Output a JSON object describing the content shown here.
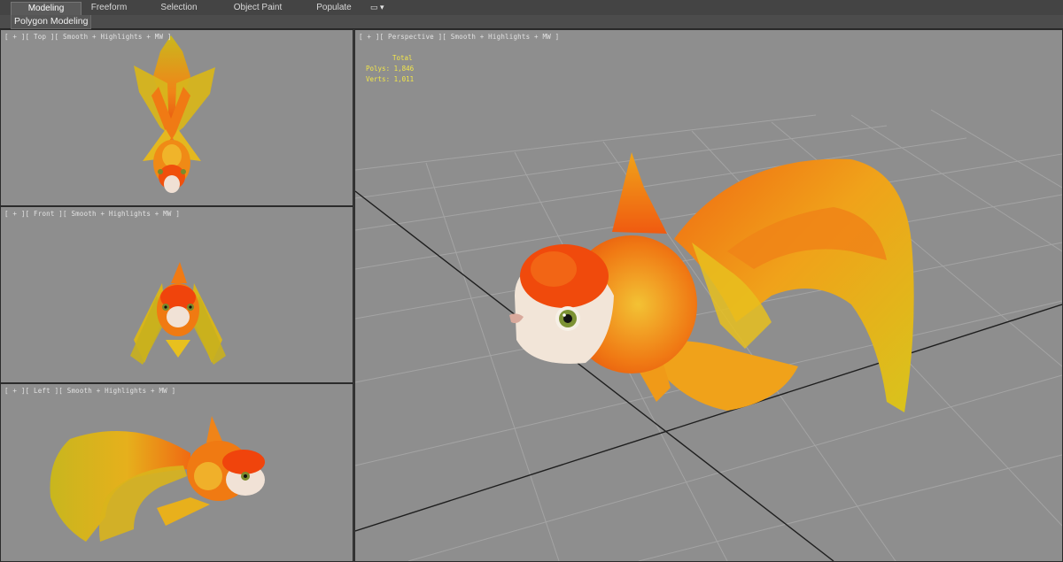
{
  "ribbon": {
    "tabs": [
      {
        "label": "Modeling",
        "active": true
      },
      {
        "label": "Freeform",
        "active": false
      },
      {
        "label": "Selection",
        "active": false
      },
      {
        "label": "Object Paint",
        "active": false
      },
      {
        "label": "Populate",
        "active": false
      }
    ],
    "menu_icon": "camera-icon",
    "menu_glyph": "▭ ▾",
    "sub_label": "Polygon Modeling"
  },
  "viewports": {
    "top": {
      "label": "[ + ][ Top ][ Smooth + Highlights + MW ]"
    },
    "front": {
      "label": "[ + ][ Front ][ Smooth + Highlights + MW ]"
    },
    "left": {
      "label": "[ + ][ Left ][ Smooth + Highlights + MW ]"
    },
    "perspective": {
      "label": "[ + ][ Perspective ][ Smooth + Highlights + MW ]",
      "stats": {
        "header": "Total",
        "polys": "Polys: 1,846",
        "verts": "Verts: 1,011"
      }
    }
  },
  "colors": {
    "viewport_bg": "#8e8e8e",
    "grid_line": "#a4a4a4",
    "grid_axis": "#1e1e1e",
    "stats_text": "#f2e64a",
    "fin_yellow": "#e7c61c",
    "body_orange": "#f06a10",
    "head_red": "#f0440c"
  }
}
